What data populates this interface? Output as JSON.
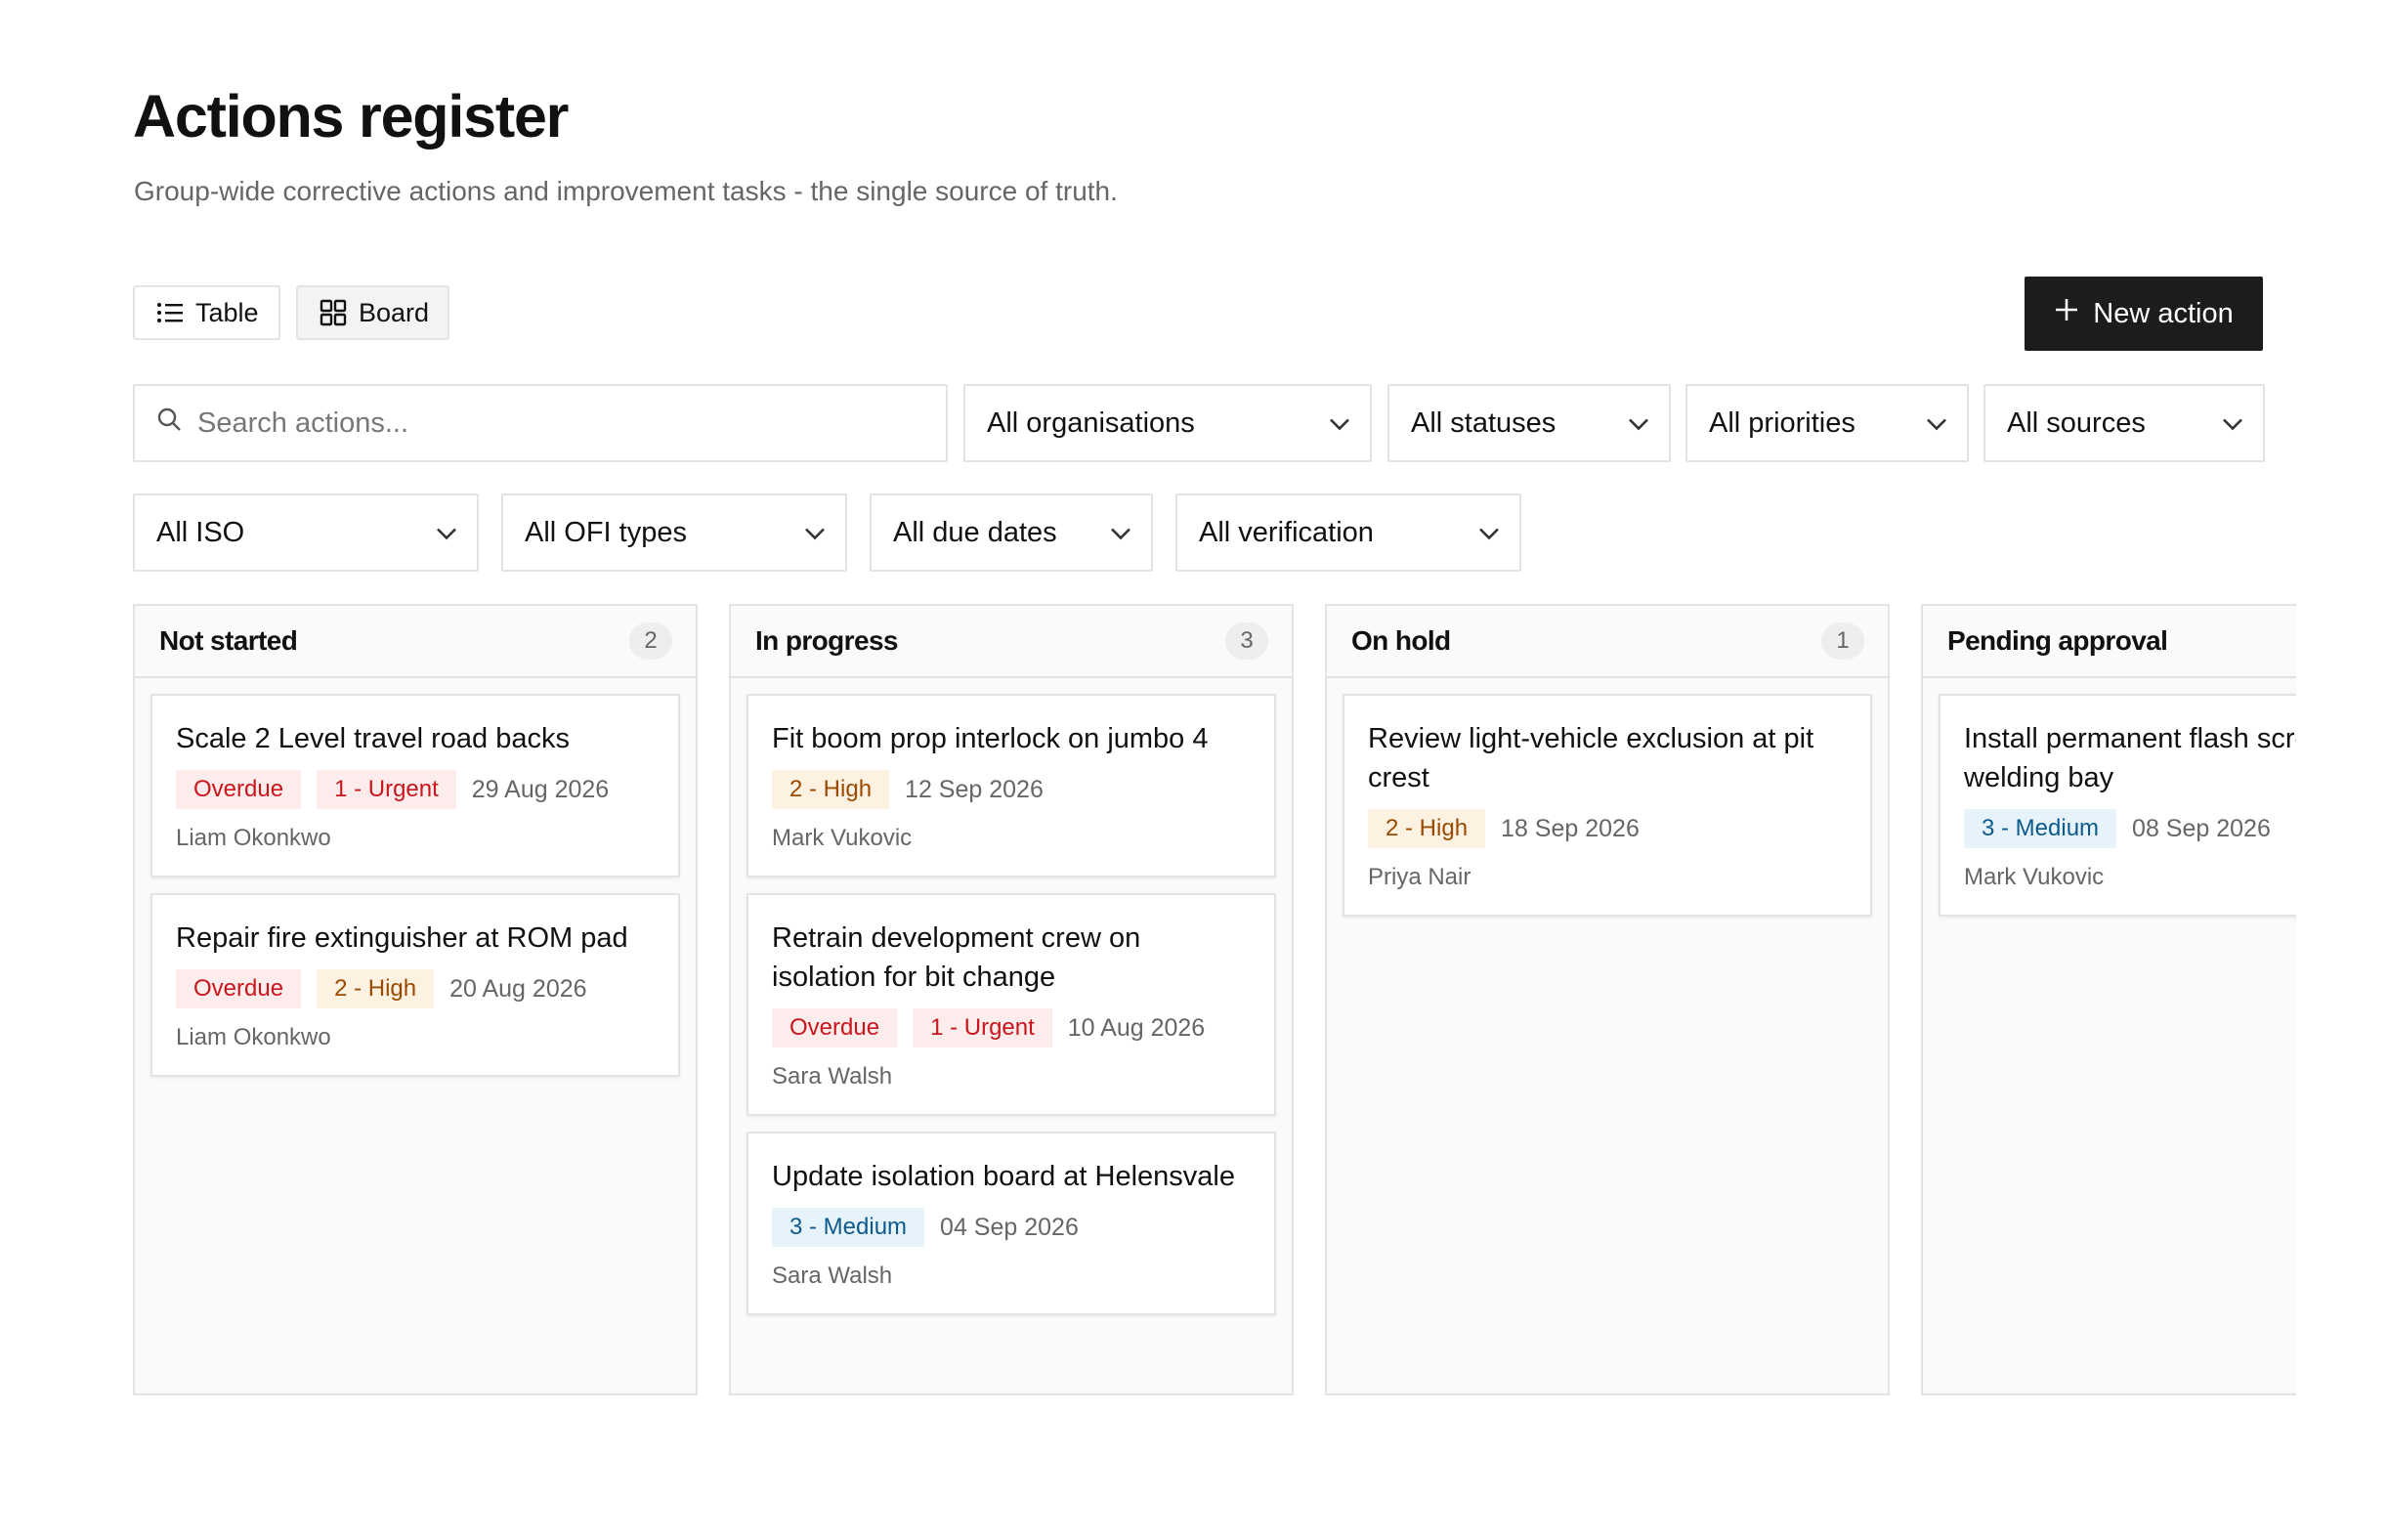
{
  "page": {
    "title": "Actions register",
    "subtitle": "Group-wide corrective actions and improvement tasks - the single source of truth."
  },
  "views": {
    "table_label": "Table",
    "board_label": "Board"
  },
  "new_action_label": "New action",
  "search": {
    "placeholder": "Search actions..."
  },
  "filters": {
    "organisations": "All organisations",
    "statuses": "All statuses",
    "priorities": "All priorities",
    "sources": "All sources",
    "iso": "All ISO",
    "ofi_types": "All OFI types",
    "due_dates": "All due dates",
    "verification": "All verification"
  },
  "columns": [
    {
      "title": "Not started",
      "count": "2",
      "cards": [
        {
          "title": "Scale 2 Level travel road backs",
          "tags": [
            "Overdue",
            "1 - Urgent"
          ],
          "date": "29 Aug 2026",
          "owner": "Liam Okonkwo"
        },
        {
          "title": "Repair fire extinguisher at ROM pad",
          "tags": [
            "Overdue",
            "2 - High"
          ],
          "date": "20 Aug 2026",
          "owner": "Liam Okonkwo"
        }
      ]
    },
    {
      "title": "In progress",
      "count": "3",
      "cards": [
        {
          "title": "Fit boom prop interlock on jumbo 4",
          "tags": [
            "2 - High"
          ],
          "date": "12 Sep 2026",
          "owner": "Mark Vukovic"
        },
        {
          "title": "Retrain development crew on isolation for bit change",
          "tags": [
            "Overdue",
            "1 - Urgent"
          ],
          "date": "10 Aug 2026",
          "owner": "Sara Walsh"
        },
        {
          "title": "Update isolation board at Helensvale",
          "tags": [
            "3 - Medium"
          ],
          "date": "04 Sep 2026",
          "owner": "Sara Walsh"
        }
      ]
    },
    {
      "title": "On hold",
      "count": "1",
      "cards": [
        {
          "title": "Review light-vehicle exclusion at pit crest",
          "tags": [
            "2 - High"
          ],
          "date": "18 Sep 2026",
          "owner": "Priya Nair"
        }
      ]
    },
    {
      "title": "Pending approval",
      "count": "",
      "cards": [
        {
          "title": "Install permanent flash screen at welding bay",
          "tags": [
            "3 - Medium"
          ],
          "date": "08 Sep 2026",
          "owner": "Mark Vukovic"
        }
      ]
    }
  ],
  "icons": {
    "table": "list-icon",
    "board": "grid-icon",
    "new": "plus-icon",
    "search": "search-icon",
    "dropdown": "chevron-down-icon"
  }
}
